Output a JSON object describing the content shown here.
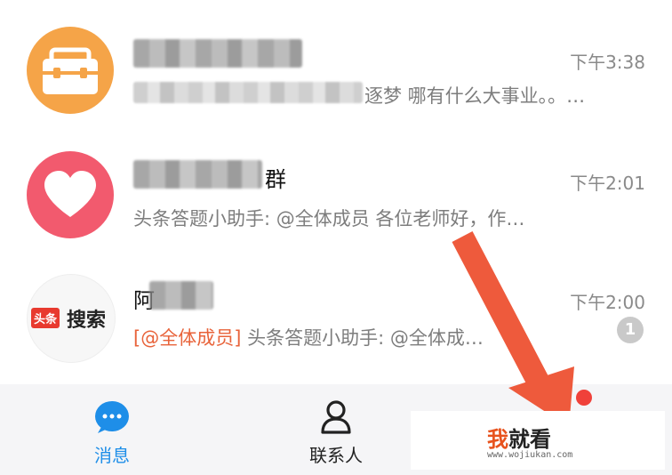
{
  "chats": [
    {
      "time": "下午3:38",
      "preview_visible": "逐梦 哪有什么大事业。。…",
      "avatar_color": "#f5a448",
      "avatar_icon": "briefcase-icon"
    },
    {
      "name_visible": "群",
      "time": "下午2:01",
      "preview": "头条答题小助手: @全体成员 各位老师好，作…",
      "avatar_color": "#f25a6e",
      "avatar_icon": "heart-icon"
    },
    {
      "name_visible": "阿",
      "time": "下午2:00",
      "preview_mention": "[@全体成员]",
      "preview_rest": " 头条答题小助手: @全体成",
      "preview_tail": "…",
      "unread_count": "1",
      "avatar_logo_left": "头条",
      "avatar_logo_right": "搜索"
    }
  ],
  "tabbar": {
    "tabs": [
      {
        "label": "消息",
        "icon": "chat-bubble-icon",
        "active": true
      },
      {
        "label": "联系人",
        "icon": "contact-person-icon",
        "active": false
      }
    ],
    "active_color": "#1e8ee8",
    "notification_dot_color": "#f0413a"
  },
  "overlay": {
    "arrow_color": "#ee5a3c",
    "watermark_brand": "我",
    "watermark_main": "就看",
    "watermark_url": "www.wojiukan.com"
  }
}
